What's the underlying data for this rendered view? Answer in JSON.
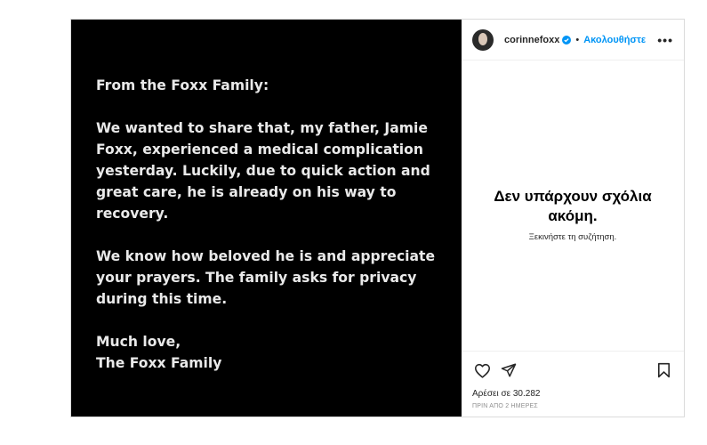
{
  "post": {
    "statement": [
      "From the Foxx Family:",
      "We wanted to share that, my father, Jamie Foxx, experienced a medical complication yesterday. Luckily, due to quick action and great care, he is already on his way to recovery.",
      "We know how beloved he is and appreciate your prayers. The family asks for privacy during this time.",
      "Much love,\nThe Foxx Family"
    ]
  },
  "header": {
    "username": "corinnefoxx",
    "separator": "•",
    "follow_label": "Ακολουθήστε",
    "more": "•••"
  },
  "comments": {
    "title": "Δεν υπάρχουν σχόλια ακόμη.",
    "subtitle": "Ξεκινήστε τη συζήτηση."
  },
  "footer": {
    "likes": "Αρέσει σε 30.282",
    "timestamp": "ΠΡΙΝ ΑΠΟ 2 ΗΜΕΡΕΣ"
  },
  "colors": {
    "accent": "#0095f6",
    "media_bg": "#000000"
  }
}
